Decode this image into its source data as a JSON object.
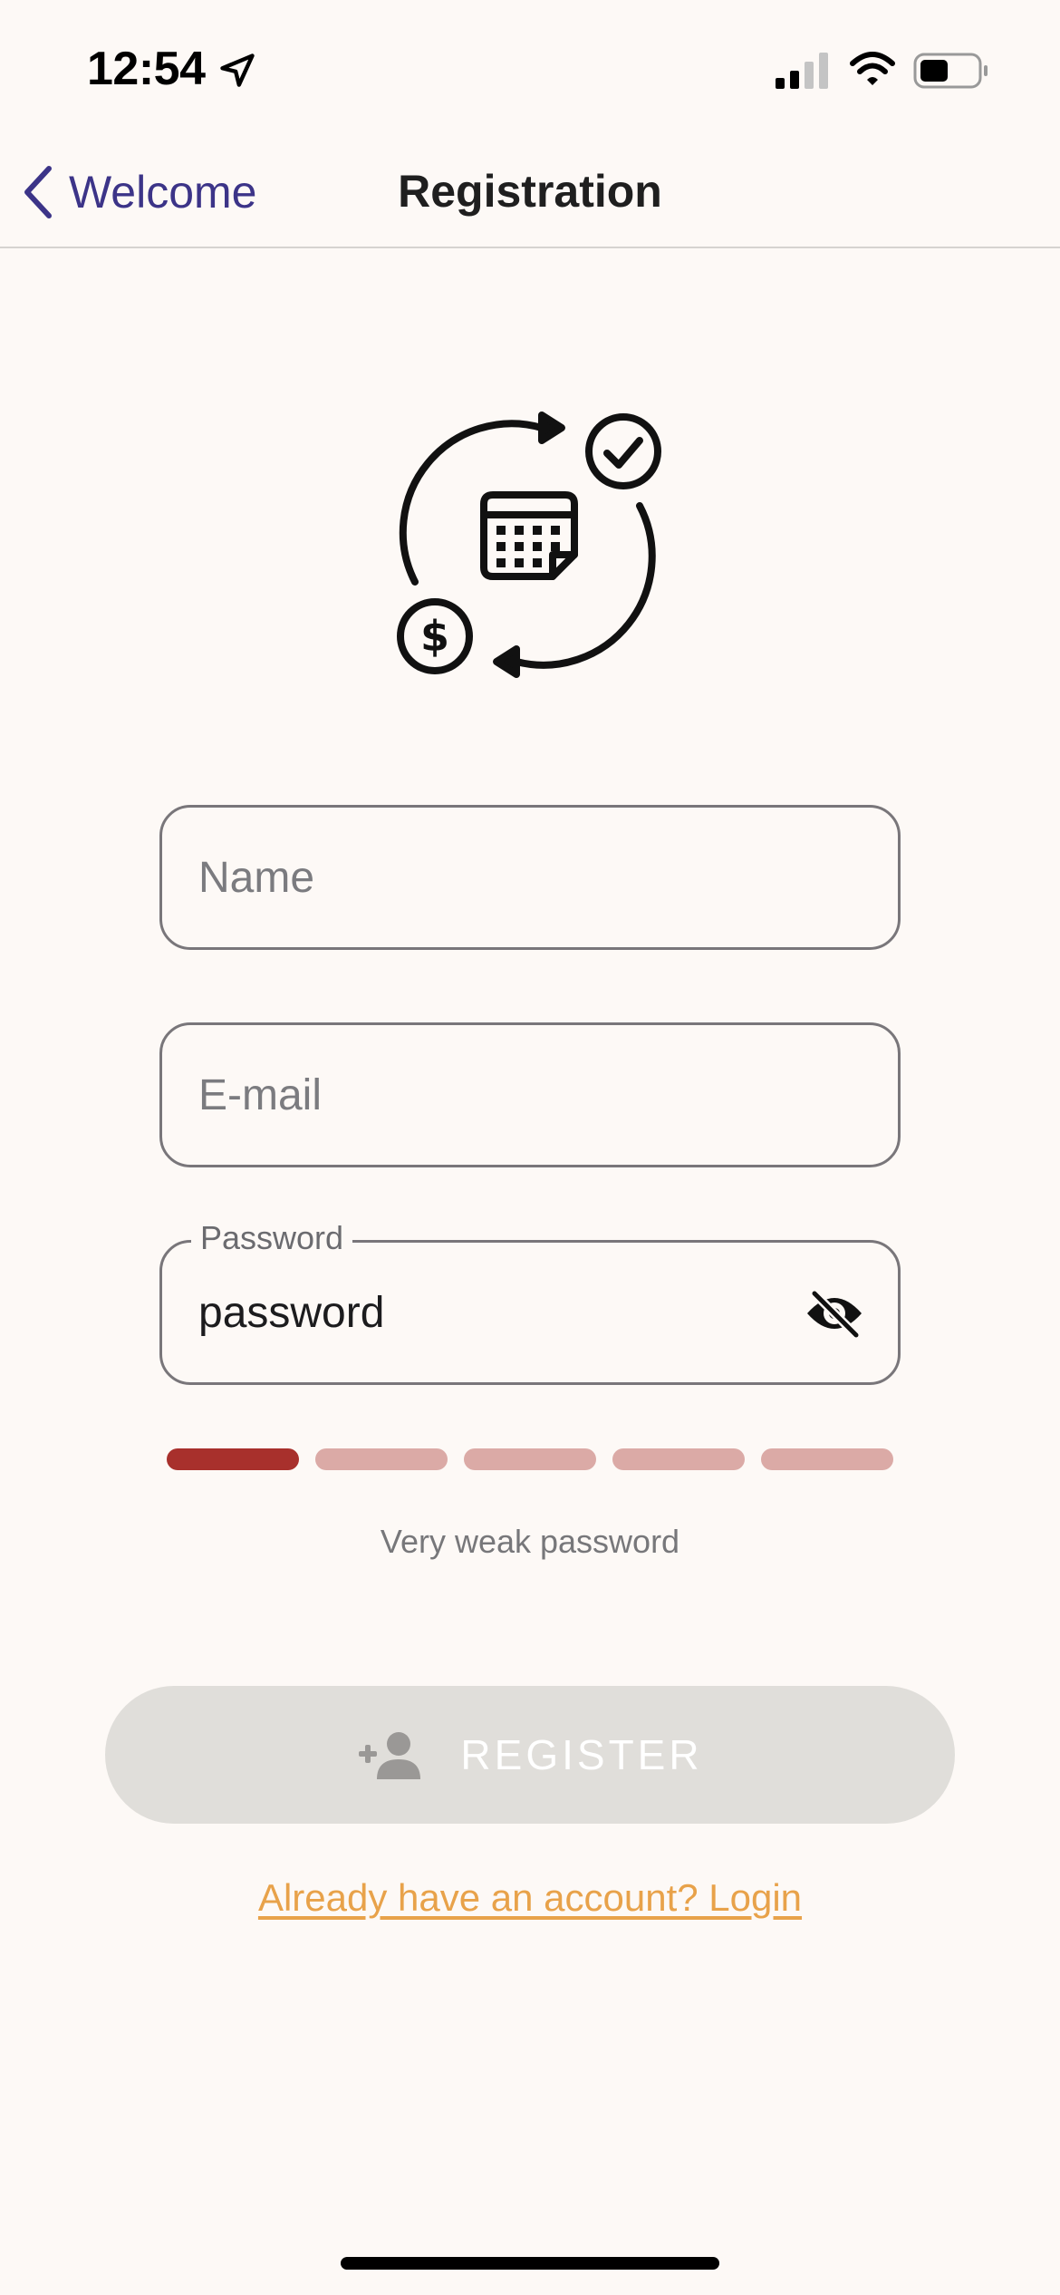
{
  "status_bar": {
    "time": "12:54",
    "icons": [
      "location-arrow-icon",
      "cellular-signal-icon",
      "wifi-icon",
      "battery-icon"
    ]
  },
  "nav": {
    "back_label": "Welcome",
    "title": "Registration"
  },
  "hero": {
    "icon": "calendar-cycle-payment-icon"
  },
  "form": {
    "name": {
      "placeholder": "Name",
      "value": ""
    },
    "email": {
      "placeholder": "E-mail",
      "value": ""
    },
    "password": {
      "label": "Password",
      "value": "password",
      "visibility_icon": "eye-off-icon"
    }
  },
  "strength": {
    "level": 1,
    "max": 5,
    "active_color": "#a8302c",
    "inactive_color": "#dbaaa6",
    "text": "Very weak password"
  },
  "register": {
    "label": "REGISTER",
    "icon": "add-user-icon",
    "enabled": false,
    "bg_color": "#e0deda"
  },
  "login_link": "Already have an account? Login",
  "colors": {
    "background": "#fdf9f6",
    "nav_accent": "#3c3488",
    "link_accent": "#e8a24a"
  }
}
